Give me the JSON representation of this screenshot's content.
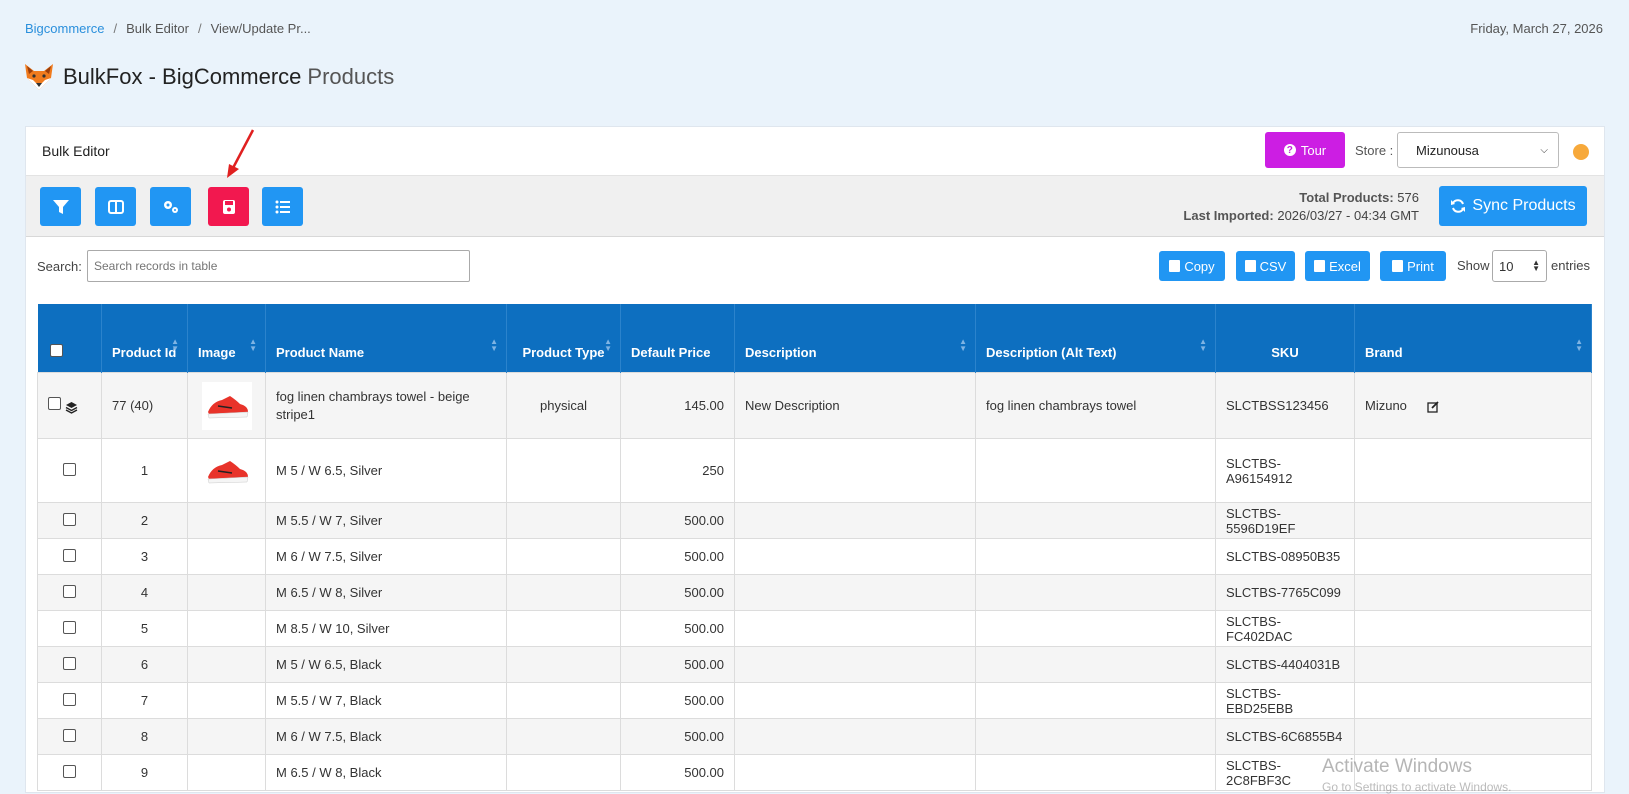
{
  "breadcrumb": {
    "home": "Bigcommerce",
    "section": "Bulk Editor",
    "current": "View/Update Pr...",
    "sep": "/"
  },
  "date": "Friday, March 27, 2026",
  "header": {
    "brand": "BulkFox - BigCommerce",
    "subtitle": "Products"
  },
  "card": {
    "title": "Bulk Editor",
    "tour_label": "Tour",
    "store_label": "Store :",
    "store_value": "Mizunousa",
    "status_color": "#f7a93b"
  },
  "toolbar": {
    "buttons": [
      "filter-icon",
      "columns-icon",
      "settings-icon",
      "save-icon",
      "list-icon"
    ],
    "total_products_label": "Total Products:",
    "total_products_value": "576",
    "last_imported_label": "Last Imported:",
    "last_imported_value": "2026/03/27 - 04:34 GMT",
    "sync_label": "Sync Products"
  },
  "search": {
    "label": "Search:",
    "placeholder": "Search records in table"
  },
  "export": {
    "copy": "Copy",
    "csv": "CSV",
    "excel": "Excel",
    "print": "Print"
  },
  "entries": {
    "show": "Show",
    "value": "10",
    "suffix": "entries"
  },
  "table": {
    "columns": [
      "Product Id",
      "Image",
      "Product Name",
      "Product Type",
      "Default Price",
      "Description",
      "Description (Alt Text)",
      "SKU",
      "Brand"
    ],
    "parent": {
      "id": "77 (40)",
      "name": "fog linen chambrays towel - beige stripe1",
      "type": "physical",
      "price": "145.00",
      "description": "New Description",
      "alt": "fog linen chambrays towel",
      "sku": "SLCTBSS123456",
      "brand": "Mizuno"
    },
    "rows": [
      {
        "id": "1",
        "name": "M 5 / W 6.5, Silver",
        "price": "250",
        "sku": "SLCTBS-A96154912"
      },
      {
        "id": "2",
        "name": "M 5.5 / W 7, Silver",
        "price": "500.00",
        "sku": "SLCTBS-5596D19EF"
      },
      {
        "id": "3",
        "name": "M 6 / W 7.5, Silver",
        "price": "500.00",
        "sku": "SLCTBS-08950B35"
      },
      {
        "id": "4",
        "name": "M 6.5 / W 8, Silver",
        "price": "500.00",
        "sku": "SLCTBS-7765C099"
      },
      {
        "id": "5",
        "name": "M 8.5 / W 10, Silver",
        "price": "500.00",
        "sku": "SLCTBS-FC402DAC"
      },
      {
        "id": "6",
        "name": "M 5 / W 6.5, Black",
        "price": "500.00",
        "sku": "SLCTBS-4404031B"
      },
      {
        "id": "7",
        "name": "M 5.5 / W 7, Black",
        "price": "500.00",
        "sku": "SLCTBS-EBD25EBB"
      },
      {
        "id": "8",
        "name": "M 6 / W 7.5, Black",
        "price": "500.00",
        "sku": "SLCTBS-6C6855B4"
      },
      {
        "id": "9",
        "name": "M 6.5 / W 8, Black",
        "price": "500.00",
        "sku": "SLCTBS-2C8FBF3C"
      }
    ]
  },
  "watermark": {
    "line1": "Activate Windows",
    "line2": "Go to Settings to activate Windows."
  }
}
